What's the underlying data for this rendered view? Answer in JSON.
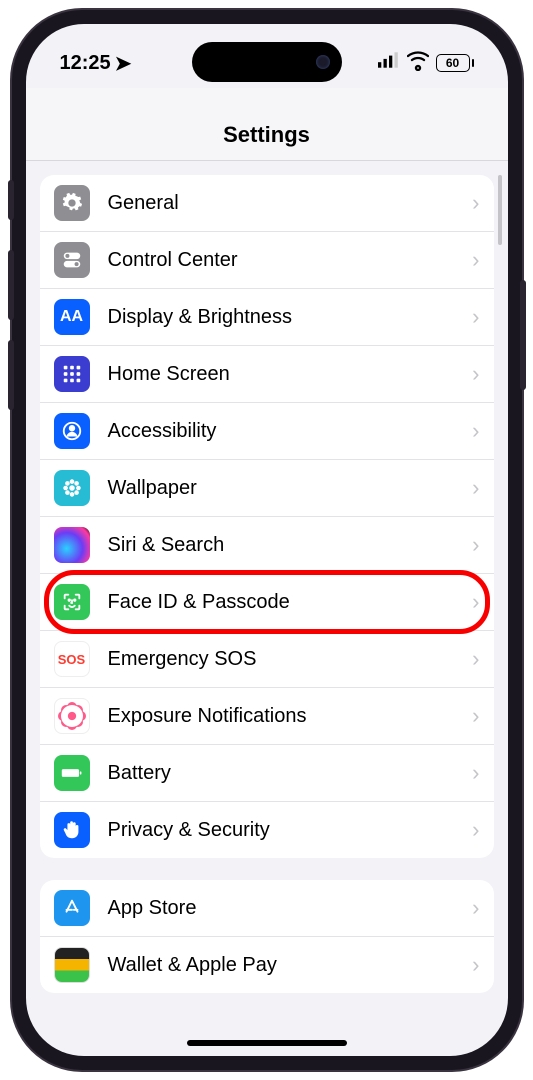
{
  "status": {
    "time": "12:25",
    "location_icon": "➤",
    "battery_pct": "60"
  },
  "header": {
    "title": "Settings"
  },
  "groups": [
    {
      "items": [
        {
          "id": "general",
          "label": "General",
          "icon": "gear-icon",
          "cls": "ic-general"
        },
        {
          "id": "control-center",
          "label": "Control Center",
          "icon": "toggles-icon",
          "cls": "ic-control"
        },
        {
          "id": "display",
          "label": "Display & Brightness",
          "icon": "aa-icon",
          "cls": "ic-display"
        },
        {
          "id": "home-screen",
          "label": "Home Screen",
          "icon": "grid-icon",
          "cls": "ic-home"
        },
        {
          "id": "accessibility",
          "label": "Accessibility",
          "icon": "person-icon",
          "cls": "ic-access"
        },
        {
          "id": "wallpaper",
          "label": "Wallpaper",
          "icon": "flower-icon",
          "cls": "ic-wall"
        },
        {
          "id": "siri",
          "label": "Siri & Search",
          "icon": "siri-icon",
          "cls": "ic-siri"
        },
        {
          "id": "face-id",
          "label": "Face ID & Passcode",
          "icon": "faceid-icon",
          "cls": "ic-face",
          "highlight": true
        },
        {
          "id": "sos",
          "label": "Emergency SOS",
          "icon": "sos-icon",
          "cls": "ic-sos",
          "text_icon": "SOS"
        },
        {
          "id": "exposure",
          "label": "Exposure Notifications",
          "icon": "exposure-icon",
          "cls": "ic-exp"
        },
        {
          "id": "battery",
          "label": "Battery",
          "icon": "battery-icon",
          "cls": "ic-batt"
        },
        {
          "id": "privacy",
          "label": "Privacy & Security",
          "icon": "hand-icon",
          "cls": "ic-priv"
        }
      ]
    },
    {
      "items": [
        {
          "id": "app-store",
          "label": "App Store",
          "icon": "appstore-icon",
          "cls": "ic-appstore"
        },
        {
          "id": "wallet",
          "label": "Wallet & Apple Pay",
          "icon": "wallet-icon",
          "cls": "ic-wallet"
        }
      ]
    }
  ]
}
